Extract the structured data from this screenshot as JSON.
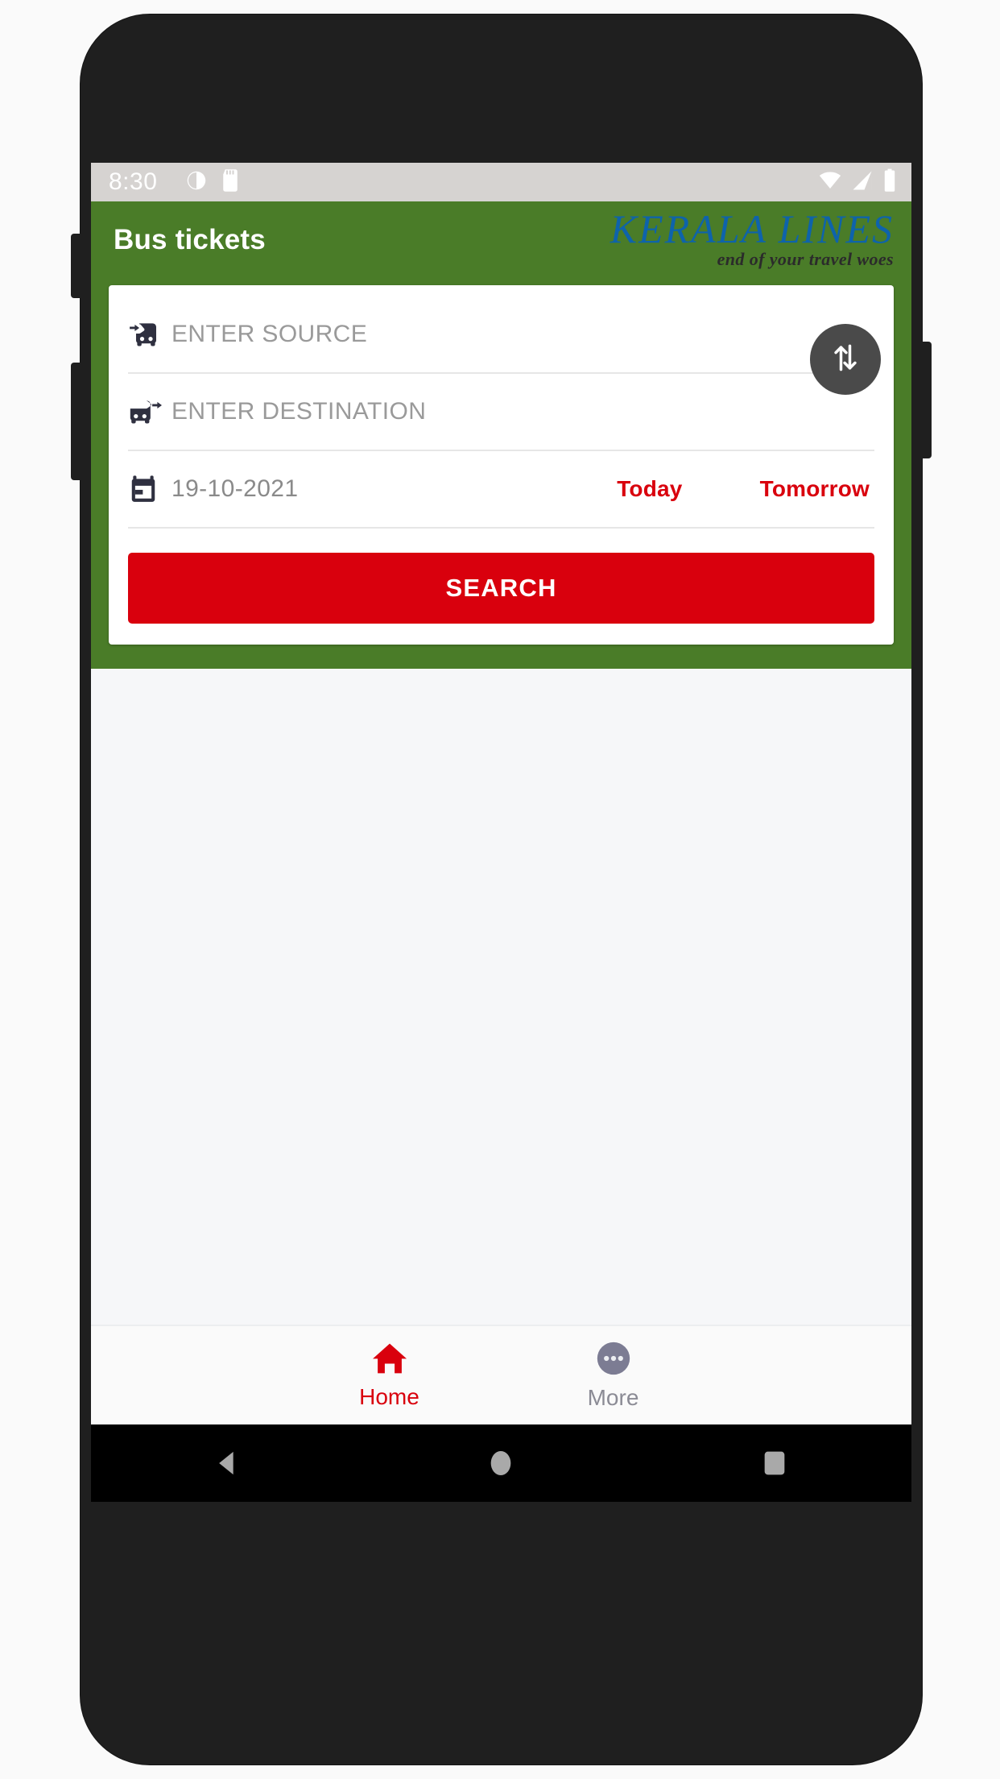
{
  "status_bar": {
    "time": "8:30",
    "left_icons": [
      "alarm-circle-icon",
      "sd-card-icon"
    ],
    "right_icons": [
      "wifi-icon",
      "cellular-signal-icon",
      "battery-icon"
    ]
  },
  "app_bar": {
    "title": "Bus tickets",
    "brand_name": "KERALA LINES",
    "brand_tagline": "end of your travel woes",
    "background_color": "#4a7c28",
    "brand_color": "#0e63ab"
  },
  "search_form": {
    "source": {
      "icon": "bus-arrival-icon",
      "value": "",
      "placeholder": "ENTER SOURCE"
    },
    "destination": {
      "icon": "bus-departure-icon",
      "value": "",
      "placeholder": "ENTER DESTINATION"
    },
    "date": {
      "icon": "calendar-icon",
      "value": "19-10-2021"
    },
    "today_label": "Today",
    "tomorrow_label": "Tomorrow",
    "swap_icon": "swap-vertical-icon",
    "search_label": "SEARCH",
    "accent_color": "#d9000d"
  },
  "bottom_nav": {
    "items": [
      {
        "label": "Home",
        "icon": "home-icon",
        "active": true,
        "color": "#d9000d"
      },
      {
        "label": "More",
        "icon": "more-ellipsis-icon",
        "active": false,
        "color": "#8b8b95"
      }
    ]
  },
  "android_nav": {
    "back": "back-triangle-icon",
    "home": "home-circle-icon",
    "recents": "recents-square-icon"
  }
}
